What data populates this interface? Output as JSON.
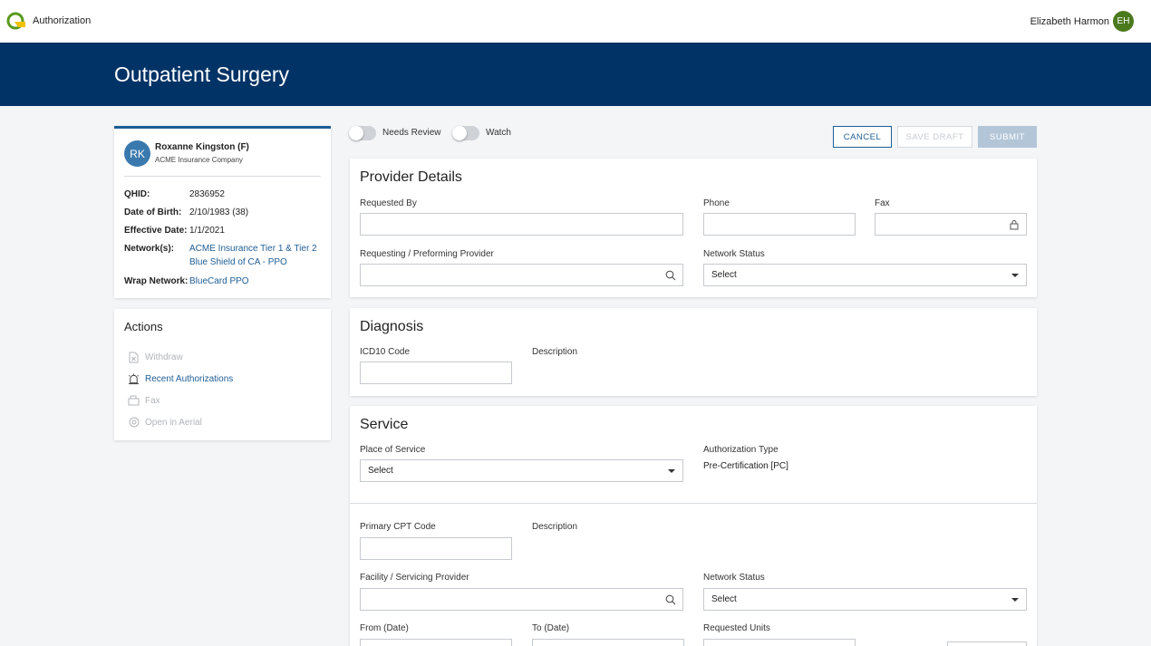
{
  "header": {
    "app_title": "Authorization",
    "user_name": "Elizabeth Harmon",
    "user_initials": "EH",
    "logo_icon": "authorization-logo-icon"
  },
  "banner": {
    "title": "Outpatient Surgery"
  },
  "member": {
    "initials": "RK",
    "name": "Roxanne Kingston (F)",
    "company": "ACME Insurance Company",
    "qhid_label": "QHID:",
    "qhid": "2836952",
    "dob_label": "Date of Birth:",
    "dob": "2/10/1983 (38)",
    "effective_label": "Effective Date:",
    "effective": "1/1/2021",
    "networks_label": "Network(s):",
    "networks": [
      "ACME Insurance Tier 1 & Tier 2",
      "Blue Shield of CA - PPO"
    ],
    "wrap_label": "Wrap Network:",
    "wrap": "BlueCard PPO"
  },
  "actions": {
    "title": "Actions",
    "items": [
      {
        "label": "Withdraw",
        "icon": "document-x-icon",
        "enabled": false
      },
      {
        "label": "Recent Authorizations",
        "icon": "siren-icon",
        "enabled": true
      },
      {
        "label": "Fax",
        "icon": "fax-icon",
        "enabled": false
      },
      {
        "label": "Open in Aerial",
        "icon": "aerial-icon",
        "enabled": false
      }
    ]
  },
  "toggles": {
    "needs_review": "Needs Review",
    "watch": "Watch"
  },
  "buttons": {
    "cancel": "CANCEL",
    "save_draft": "SAVE DRAFT",
    "submit": "SUBMIT"
  },
  "provider": {
    "title": "Provider Details",
    "requested_by_label": "Requested By",
    "phone_label": "Phone",
    "fax_label": "Fax",
    "requesting_label": "Requesting / Preforming Provider",
    "network_status_label": "Network Status",
    "network_status_value": "Select"
  },
  "diagnosis": {
    "title": "Diagnosis",
    "icd_label": "ICD10 Code",
    "description_label": "Description"
  },
  "service": {
    "title": "Service",
    "place_label": "Place of Service",
    "place_value": "Select",
    "auth_type_label": "Authorization Type",
    "auth_type_value": "Pre-Certification [PC]",
    "cpt_label": "Primary CPT Code",
    "description_label": "Description",
    "facility_label": "Facility / Servicing Provider",
    "network_status_label": "Network Status",
    "network_status_value": "Select",
    "from_label": "From (Date)",
    "to_label": "To (Date)",
    "units_label": "Requested Units"
  },
  "colors": {
    "banner": "#023366",
    "accent": "#1f5e95",
    "avatar_user": "#4b7a1e"
  }
}
